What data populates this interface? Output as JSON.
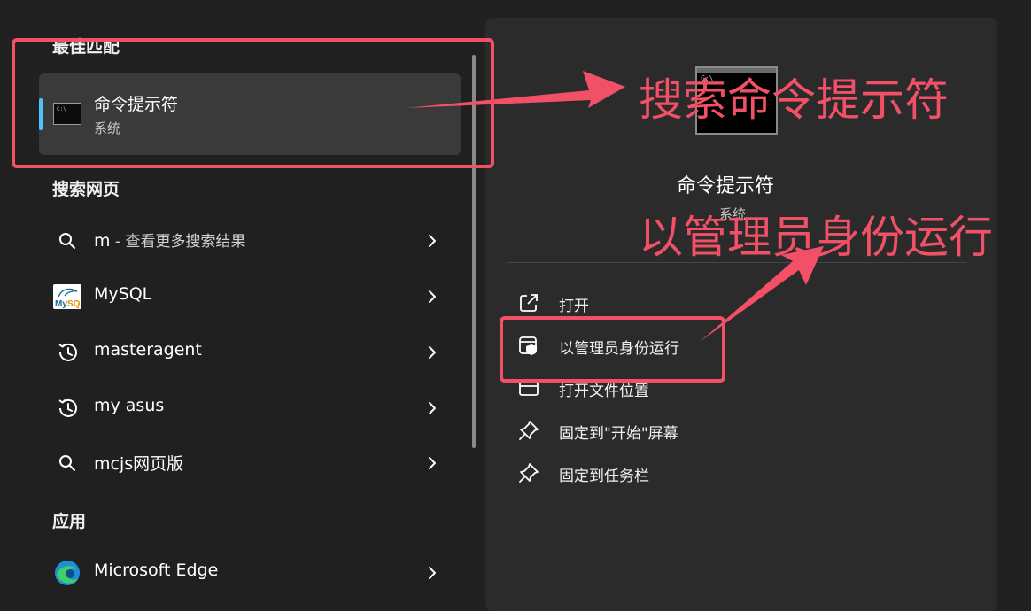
{
  "left_panel": {
    "best_match": {
      "header": "最佳匹配",
      "title": "命令提示符",
      "subtitle": "系统"
    },
    "web_search": {
      "header": "搜索网页",
      "items": [
        {
          "label": "m",
          "suffix": " - 查看更多搜索结果",
          "icon": "search-icon"
        },
        {
          "label": "MySQL",
          "suffix": "",
          "icon": "mysql-icon"
        },
        {
          "label": "masteragent",
          "suffix": "",
          "icon": "history-icon"
        },
        {
          "label": "my asus",
          "suffix": "",
          "icon": "history-icon"
        },
        {
          "label": "mcjs网页版",
          "suffix": "",
          "icon": "search-icon"
        }
      ]
    },
    "apps": {
      "header": "应用",
      "items": [
        {
          "label": "Microsoft Edge",
          "icon": "edge-icon"
        }
      ]
    }
  },
  "right_panel": {
    "app_title": "命令提示符",
    "app_subtitle": "系统",
    "actions": [
      {
        "label": "打开",
        "icon": "open-external-icon"
      },
      {
        "label": "以管理员身份运行",
        "icon": "admin-shield-icon"
      },
      {
        "label": "打开文件位置",
        "icon": "folder-icon"
      },
      {
        "label": "固定到\"开始\"屏幕",
        "icon": "pin-icon"
      },
      {
        "label": "固定到任务栏",
        "icon": "pin-icon"
      }
    ]
  },
  "annotations": {
    "search_label": "搜索命令提示符",
    "admin_label": "以管理员身份运行",
    "color": "#f25067"
  },
  "colors": {
    "accent": "#4cc2ff",
    "background": "#202020",
    "panel": "#2b2b2b"
  }
}
